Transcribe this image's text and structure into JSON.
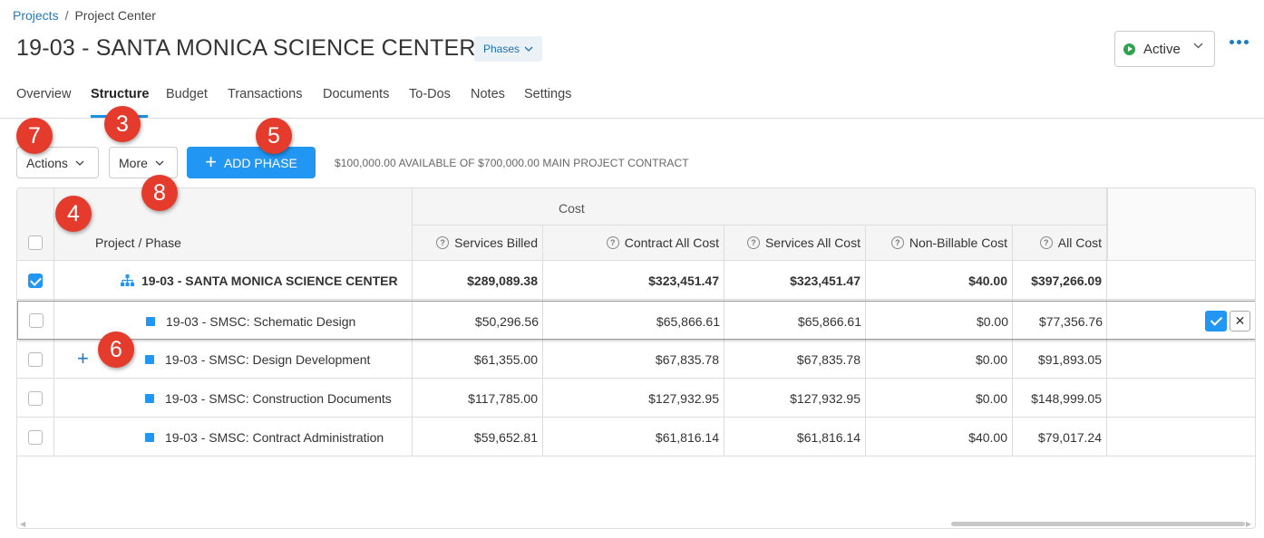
{
  "breadcrumb": {
    "root": "Projects",
    "separator": "/",
    "current": "Project Center"
  },
  "header": {
    "title": "19-03 - SANTA MONICA SCIENCE CENTER",
    "phases_label": "Phases",
    "status_label": "Active",
    "status_color": "#2ea44f"
  },
  "tabs": [
    {
      "label": "Overview"
    },
    {
      "label": "Structure",
      "active": true
    },
    {
      "label": "Budget"
    },
    {
      "label": "Transactions"
    },
    {
      "label": "Documents"
    },
    {
      "label": "To-Dos"
    },
    {
      "label": "Notes"
    },
    {
      "label": "Settings"
    }
  ],
  "toolbar": {
    "actions_label": "Actions",
    "more_label": "More",
    "add_phase_label": "ADD PHASE",
    "contract_note": "$100,000.00 AVAILABLE OF $700,000.00 MAIN PROJECT CONTRACT"
  },
  "markers": [
    "7",
    "3",
    "5",
    "8",
    "4",
    "6"
  ],
  "grid": {
    "group_header": "Cost",
    "columns": {
      "name": "Project / Phase",
      "services_billed": "Services Billed",
      "contract_all_cost": "Contract All Cost",
      "services_all_cost": "Services All Cost",
      "non_billable_cost": "Non-Billable Cost",
      "all_cost": "All Cost"
    },
    "rows": [
      {
        "name": "19-03 - SANTA MONICA SCIENCE CENTER",
        "services_billed": "$289,089.38",
        "contract_all_cost": "$323,451.47",
        "services_all_cost": "$323,451.47",
        "non_billable_cost": "$40.00",
        "all_cost": "$397,266.09",
        "checked": true
      },
      {
        "name": "19-03 - SMSC: Schematic Design",
        "services_billed": "$50,296.56",
        "contract_all_cost": "$65,866.61",
        "services_all_cost": "$65,866.61",
        "non_billable_cost": "$0.00",
        "all_cost": "$77,356.76"
      },
      {
        "name": "19-03 - SMSC: Design Development",
        "services_billed": "$61,355.00",
        "contract_all_cost": "$67,835.78",
        "services_all_cost": "$67,835.78",
        "non_billable_cost": "$0.00",
        "all_cost": "$91,893.05"
      },
      {
        "name": "19-03 - SMSC: Construction Documents",
        "services_billed": "$117,785.00",
        "contract_all_cost": "$127,932.95",
        "services_all_cost": "$127,932.95",
        "non_billable_cost": "$0.00",
        "all_cost": "$148,999.05"
      },
      {
        "name": "19-03 - SMSC: Contract Administration",
        "services_billed": "$59,652.81",
        "contract_all_cost": "$61,816.14",
        "services_all_cost": "$61,816.14",
        "non_billable_cost": "$40.00",
        "all_cost": "$79,017.24"
      }
    ]
  },
  "accent_color": "#2196f3"
}
